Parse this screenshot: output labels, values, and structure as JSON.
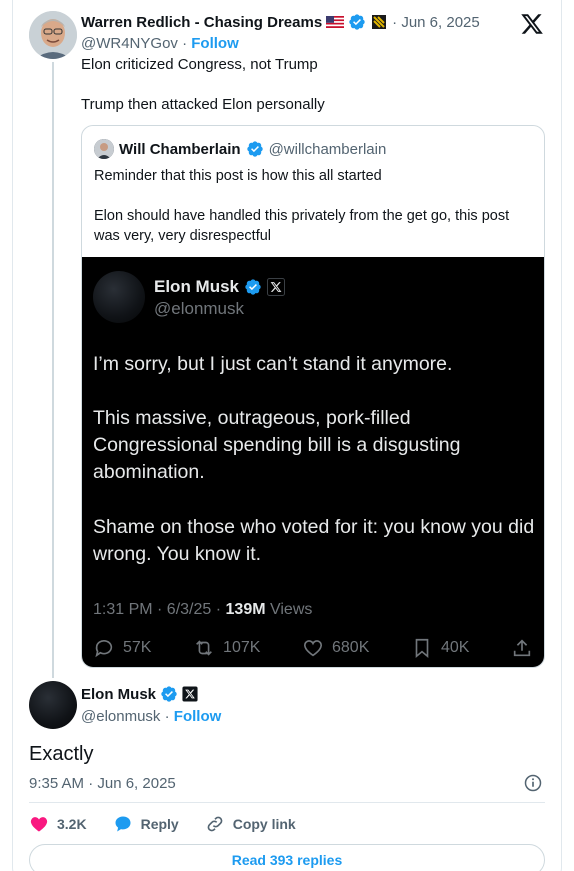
{
  "main_tweet": {
    "author_name": "Warren Redlich - Chasing Dreams",
    "handle": "@WR4NYGov",
    "separator": " · ",
    "follow_label": "Follow",
    "date": "· Jun 6, 2025",
    "text_line1": "Elon criticized Congress, not Trump",
    "text_line2": "Trump then attacked Elon personally"
  },
  "quoted_tweet": {
    "author_name": "Will Chamberlain",
    "handle": "@willchamberlain",
    "text_line1": "Reminder that this post is how this all started",
    "text_line2": "Elon should have handled this privately from the get go, this post was very, very disrespectful"
  },
  "embedded_image_tweet": {
    "author_name": "Elon Musk",
    "handle": "@elonmusk",
    "para1": "I’m sorry, but I just can’t stand it anymore.",
    "para2": "This massive, outrageous, pork-filled Congressional spending bill is a disgusting abomination.",
    "para3": "Shame on those who voted for it: you know you did wrong. You know it.",
    "meta_time": "1:31 PM · 6/3/25 · ",
    "meta_views": "139M",
    "meta_views_label": " Views",
    "replies": "57K",
    "reposts": "107K",
    "likes": "680K",
    "bookmarks": "40K"
  },
  "reply": {
    "author_name": "Elon Musk",
    "handle": "@elonmusk",
    "separator": " · ",
    "follow_label": "Follow",
    "text": "Exactly",
    "timestamp": "9:35 AM · Jun 6, 2025"
  },
  "actions": {
    "likes": "3.2K",
    "reply_label": "Reply",
    "copy_link_label": "Copy link"
  },
  "read_replies_label": "Read 393 replies",
  "colors": {
    "accent_blue": "#1d9bf0",
    "like_pink": "#f91880",
    "text_primary": "#0f1419",
    "text_secondary": "#536471"
  },
  "icons": [
    "x-logo-icon",
    "us-flag-icon",
    "verified-badge-icon",
    "affiliate-badge-icon",
    "x-affiliate-icon",
    "reply-icon",
    "repost-icon",
    "like-icon",
    "bookmark-icon",
    "share-icon",
    "info-icon",
    "heart-icon",
    "reply-bubble-icon",
    "link-icon"
  ]
}
